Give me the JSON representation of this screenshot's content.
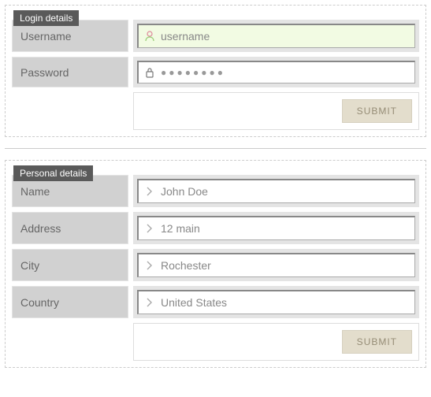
{
  "login": {
    "legend": "Login details",
    "username_label": "Username",
    "username_value": "username",
    "password_label": "Password",
    "password_mask": "●●●●●●●●",
    "submit": "SUBMIT"
  },
  "personal": {
    "legend": "Personal details",
    "name_label": "Name",
    "name_value": "John Doe",
    "address_label": "Address",
    "address_value": "12 main",
    "city_label": "City",
    "city_value": "Rochester",
    "country_label": "Country",
    "country_value": "United States",
    "submit": "SUBMIT"
  }
}
